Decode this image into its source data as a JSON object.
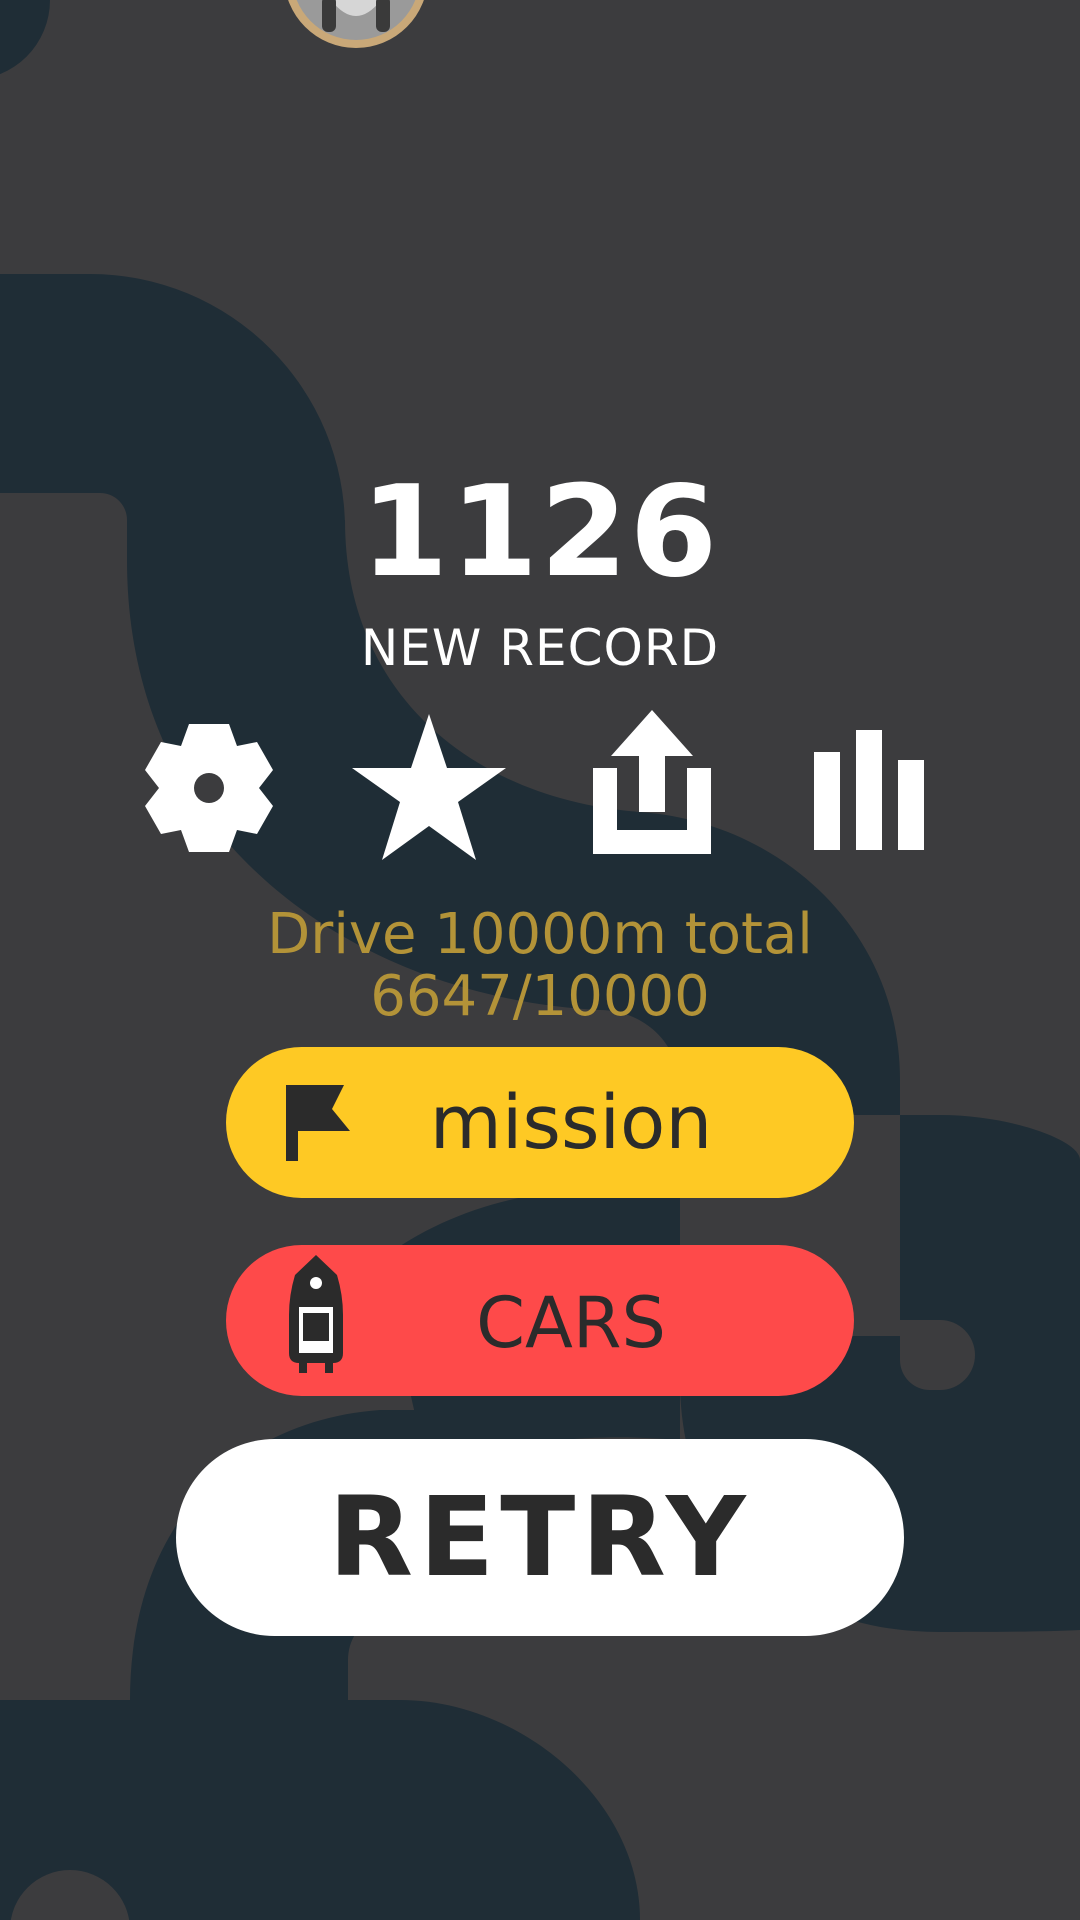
{
  "colors": {
    "background": "#3c3c3e",
    "road": "#1f2d36",
    "mission_yellow": "#fec924",
    "cars_red": "#fe4a4a",
    "retry_white": "#ffffff",
    "progress_gold": "#b39338",
    "text_dark": "#2b2b2b"
  },
  "score": {
    "value": "1126",
    "subtitle": "NEW RECORD"
  },
  "icons": {
    "settings": "gear-icon",
    "rate": "star-icon",
    "share": "share-icon",
    "leaderboard": "leaderboard-icon"
  },
  "mission": {
    "description": "Drive 10000m total",
    "progress_text": "6647/10000"
  },
  "buttons": {
    "mission_label": "mission",
    "mission_icon": "flag-icon",
    "cars_label": "CARS",
    "cars_icon": "car-icon",
    "retry_label": "RETRY"
  },
  "avatar": {
    "icon": "raccoon-avatar-icon"
  }
}
